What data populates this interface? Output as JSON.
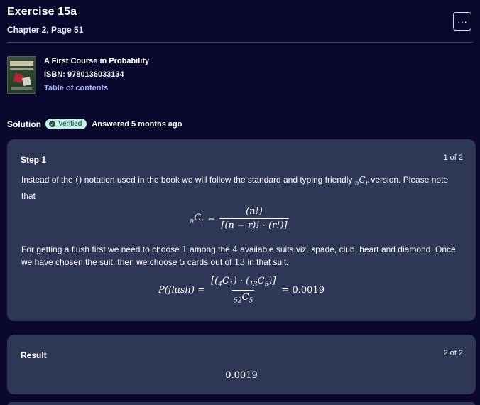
{
  "header": {
    "title": "Exercise 15a",
    "subtitle": "Chapter 2, Page 51",
    "more_label": "···"
  },
  "book": {
    "cover_text": "A FIRST COURSE IN PROBABILITY",
    "title": "A First Course in Probability",
    "isbn": "ISBN: 9780136033134",
    "toc_label": "Table of contents"
  },
  "solution": {
    "label": "Solution",
    "badge": "Verified",
    "answered": "Answered 5 months ago"
  },
  "step1": {
    "label": "Step 1",
    "counter": "1 of 2",
    "p1_a": "Instead of the",
    "p1_paren": "()",
    "p1_b": "notation used in the book we will follow the standard and typing friendly",
    "p1_c": "version. Please note that",
    "eq1_lhs": "C",
    "eq1_num": "(n!)",
    "eq1_den": "[(n − r)! · (r!)]",
    "p2_a": "For getting a flush first we need to choose",
    "p2_n1": "1",
    "p2_b": "among the",
    "p2_n2": "4",
    "p2_c": "available suits viz. spade, club, heart and diamond. Once we have chosen the suit, then we choose",
    "p2_n3": "5",
    "p2_d": "cards out of",
    "p2_n4": "13",
    "p2_e": "in that suit.",
    "eq2_lhs": "P(flush) =",
    "eq2_rhs": "= 0.0019"
  },
  "result": {
    "label": "Result",
    "counter": "2 of 2",
    "value": "0.0019"
  },
  "colors": {
    "background": "#0a092d",
    "card": "#2e3856",
    "link": "#a8b1ff",
    "badge": "#c3f1e6"
  },
  "icons": [
    "more-horizontal-icon",
    "verified-check-icon"
  ]
}
